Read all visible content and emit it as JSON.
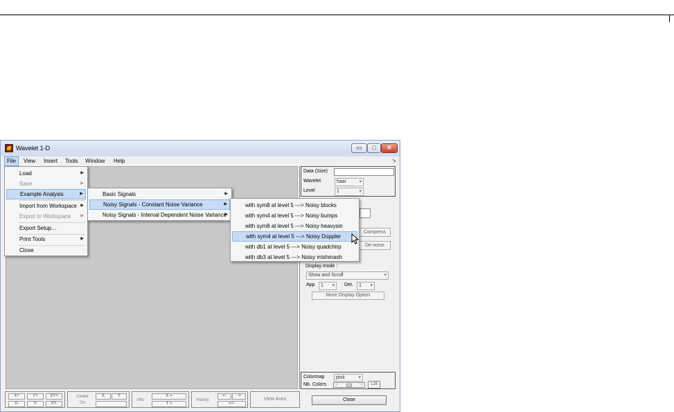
{
  "window": {
    "title": "Wavelet 1-D",
    "controls": {
      "minimize": "▭",
      "maximize": "□",
      "close": "✕"
    }
  },
  "menubar": {
    "items": [
      "File",
      "View",
      "Insert",
      "Tools",
      "Window",
      "Help"
    ],
    "dock_arrow": "➘"
  },
  "file_menu": {
    "items": [
      {
        "label": "Load",
        "submenu": true,
        "enabled": true
      },
      {
        "label": "Save",
        "submenu": true,
        "enabled": false
      },
      {
        "label": "Example Analysis",
        "submenu": true,
        "enabled": true,
        "highlighted": true
      },
      {
        "label": "Import from Workspace",
        "submenu": true,
        "enabled": true
      },
      {
        "label": "Export to Workspace",
        "submenu": true,
        "enabled": false
      },
      {
        "label": "Export Setup...",
        "submenu": false,
        "enabled": true
      },
      {
        "label": "Print Tools",
        "submenu": true,
        "enabled": true
      },
      {
        "label": "Close",
        "submenu": false,
        "enabled": true
      }
    ]
  },
  "example_menu": {
    "items": [
      {
        "label": "Basic Signals",
        "highlighted": false
      },
      {
        "label": "Noisy Signals - Constant Noise Variance",
        "highlighted": true
      },
      {
        "label": "Noisy Signals - Interval Dependent Noise Variance",
        "highlighted": false
      }
    ]
  },
  "noise_menu": {
    "items": [
      {
        "left": "with sym8 at level 5",
        "arrow": "--->",
        "right": "Noisy blocks",
        "highlighted": false
      },
      {
        "left": "with sym4 at level 5",
        "arrow": "--->",
        "right": "Noisy bumps",
        "highlighted": false
      },
      {
        "left": "with sym8 at level 5",
        "arrow": "--->",
        "right": "Noisy heavysin",
        "highlighted": false
      },
      {
        "left": "with sym4 at level 5",
        "arrow": "--->",
        "right": "Noisy Doppler",
        "highlighted": true
      },
      {
        "left": "with db1  at level 5",
        "arrow": "--->",
        "right": "Noisy quadchirp",
        "highlighted": false
      },
      {
        "left": "with db3  at level 5",
        "arrow": "--->",
        "right": "Noisy mishmash",
        "highlighted": false
      }
    ]
  },
  "right_panel": {
    "data_size_label": "Data  (Size)",
    "wavelet_label": "Wavelet",
    "wavelet_value": "haar",
    "level_label": "Level",
    "level_value": "1",
    "compress_label": "Compress",
    "denoise_label": "De-noise",
    "display_mode_label": "Display mode :",
    "display_mode_value": "Show and Scroll",
    "app_label": "App",
    "app_value": "1",
    "det_label": "Det.",
    "det_value": "1",
    "more_display_label": "More Display Option",
    "colormap_label": "Colormap",
    "colormap_value": "pink",
    "ncolors_label": "Nb. Colors",
    "ncolors_value": "128",
    "close_label": "Close"
  },
  "bottom_toolbar": {
    "zoom": [
      "X+",
      "Y+",
      "XY+",
      "X-",
      "Y-",
      "XY-"
    ],
    "center_label_1": "Center",
    "center_label_2": "On",
    "center_x": "X",
    "center_y": "Y",
    "info_label": "Info",
    "info_x": "X =",
    "info_y": "Y =",
    "history_label": "History",
    "hist_back": "<-",
    "hist_fwd": "->",
    "hist_first": "<<-",
    "view_axes": "View Axes"
  },
  "colors": {
    "highlight": "#c6dcf5",
    "axes_bg": "#c8c8c8",
    "window_bg": "#f0f0f0"
  }
}
